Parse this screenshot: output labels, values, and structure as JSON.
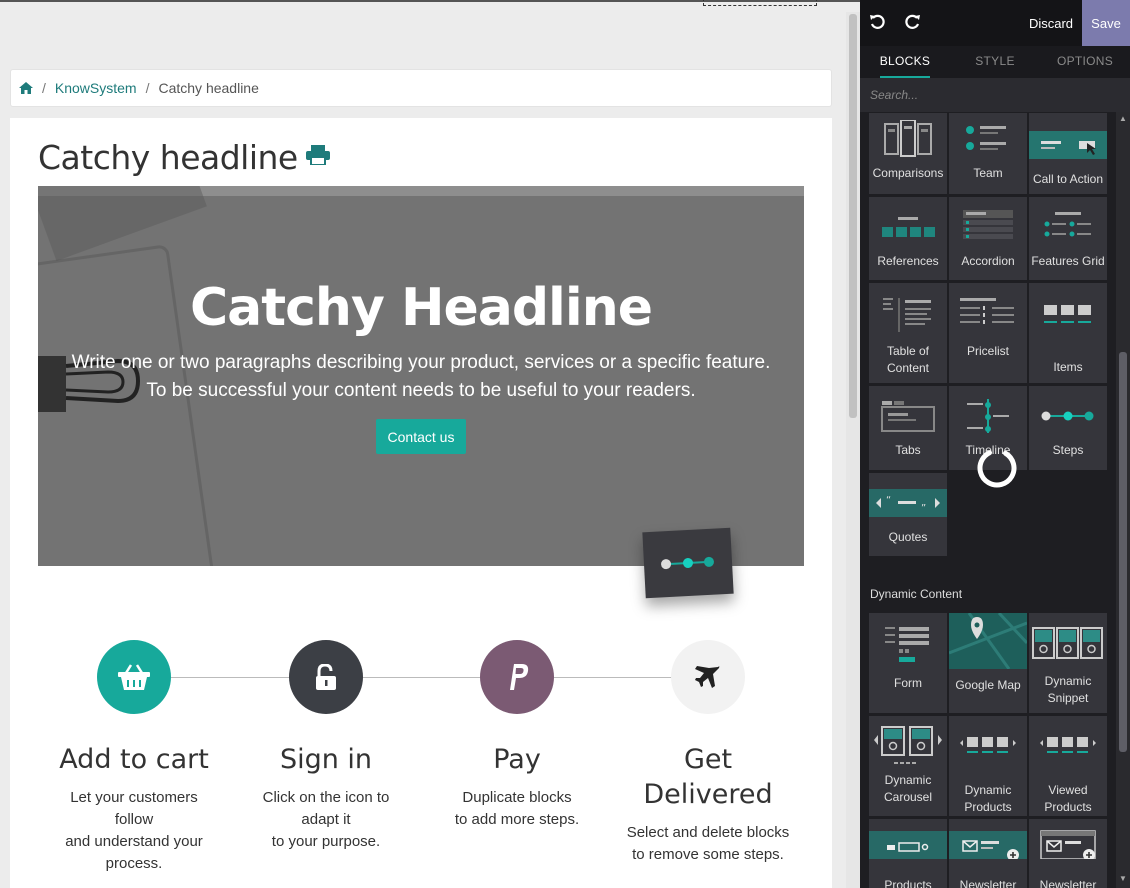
{
  "breadcrumb": {
    "home_icon": "home-icon",
    "items": [
      "KnowSystem",
      "Catchy headline"
    ]
  },
  "page": {
    "headline": "Catchy headline",
    "hero": {
      "title": "Catchy Headline",
      "line1": "Write one or two paragraphs describing your product, services or a specific feature.",
      "line2": "To be successful your content needs to be useful to your readers.",
      "button": "Contact us"
    },
    "steps": [
      {
        "title": "Add to cart",
        "desc": [
          "Let your customers",
          "follow",
          "and understand your",
          "process."
        ],
        "icon": "basket-icon",
        "color": "#17a99b"
      },
      {
        "title": "Sign in",
        "desc": [
          "Click on the icon to",
          "adapt it",
          "to your purpose."
        ],
        "icon": "unlock-icon",
        "color": "#3c3f45"
      },
      {
        "title": "Pay",
        "desc": [
          "Duplicate blocks",
          "to add more steps."
        ],
        "icon": "paypal-icon",
        "color": "#7b5a73"
      },
      {
        "title_lines": [
          "Get",
          "Delivered"
        ],
        "desc": [
          "Select and delete blocks",
          "to remove some steps."
        ],
        "icon": "plane-icon",
        "color": "#f2f2f2"
      }
    ]
  },
  "editor": {
    "discard": "Discard",
    "save": "Save",
    "tabs": [
      "BLOCKS",
      "STYLE",
      "OPTIONS"
    ],
    "search_placeholder": "Search...",
    "blocks": [
      "Comparisons",
      "Team",
      "Call to Action",
      "References",
      "Accordion",
      "Features Grid",
      "Table of Content",
      "Pricelist",
      "Items",
      "Tabs",
      "Timeline",
      "Steps",
      "Quotes"
    ],
    "dynamic_section": "Dynamic Content",
    "dynamic": [
      "Form",
      "Google Map",
      "Dynamic Snippet",
      "Dynamic Carousel",
      "Dynamic Products",
      "Viewed Products",
      "Products",
      "Newsletter",
      "Newsletter"
    ],
    "accent": "#17a99b",
    "save_color": "#7c7bad"
  }
}
